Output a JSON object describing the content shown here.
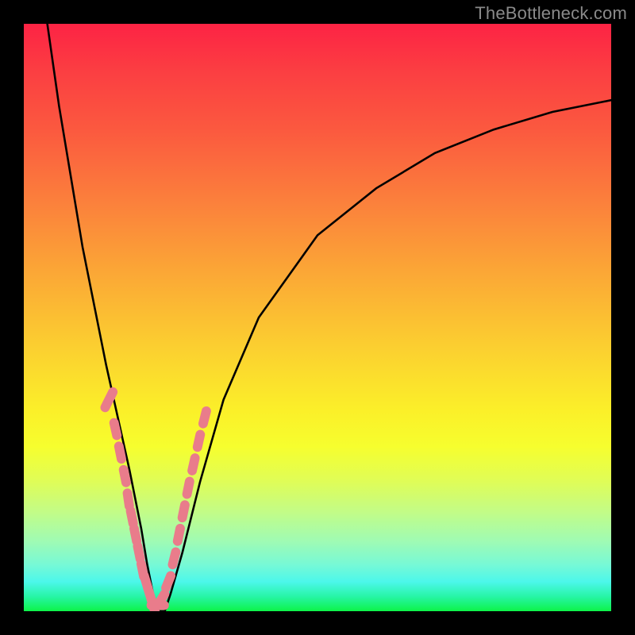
{
  "watermark": "TheBottleneck.com",
  "chart_data": {
    "type": "line",
    "title": "",
    "xlabel": "",
    "ylabel": "",
    "xlim": [
      0,
      100
    ],
    "ylim": [
      0,
      100
    ],
    "note": "Bottleneck-style V-curve on a red-to-green gradient background. Both x and y axes are unlabeled; values estimated from shape.",
    "series": [
      {
        "name": "bottleneck-curve",
        "x": [
          4,
          6,
          8,
          10,
          12,
          14,
          16,
          18,
          20,
          21,
          22,
          23,
          24,
          25,
          27,
          30,
          34,
          40,
          50,
          60,
          70,
          80,
          90,
          100
        ],
        "y": [
          100,
          86,
          74,
          62,
          52,
          42,
          33,
          24,
          14,
          8,
          3,
          0,
          0,
          3,
          10,
          22,
          36,
          50,
          64,
          72,
          78,
          82,
          85,
          87
        ]
      }
    ],
    "markers": {
      "name": "pink-segment-markers",
      "color": "#e97c8b",
      "note": "Salmon/pink bead-like marks clustered near the V trough on both branches (roughly y 5–30%).",
      "x": [
        14.5,
        15.6,
        16.4,
        17.2,
        17.8,
        18.4,
        19.0,
        19.6,
        20.2,
        20.8,
        21.4,
        22.0,
        22.8,
        23.4,
        24.6,
        25.6,
        26.4,
        27.2,
        28.0,
        28.9,
        29.8,
        30.8
      ],
      "y": [
        36,
        31,
        27,
        23,
        19,
        16,
        13,
        10,
        7,
        5,
        3,
        1,
        1,
        2,
        5,
        9,
        13,
        17,
        21,
        25,
        29,
        33
      ]
    },
    "background_gradient": {
      "stops": [
        {
          "pos": 0.0,
          "color": "#fd2344"
        },
        {
          "pos": 0.3,
          "color": "#fb7f3c"
        },
        {
          "pos": 0.66,
          "color": "#fbf029"
        },
        {
          "pos": 0.88,
          "color": "#a0fbb3"
        },
        {
          "pos": 1.0,
          "color": "#0df349"
        }
      ]
    }
  }
}
